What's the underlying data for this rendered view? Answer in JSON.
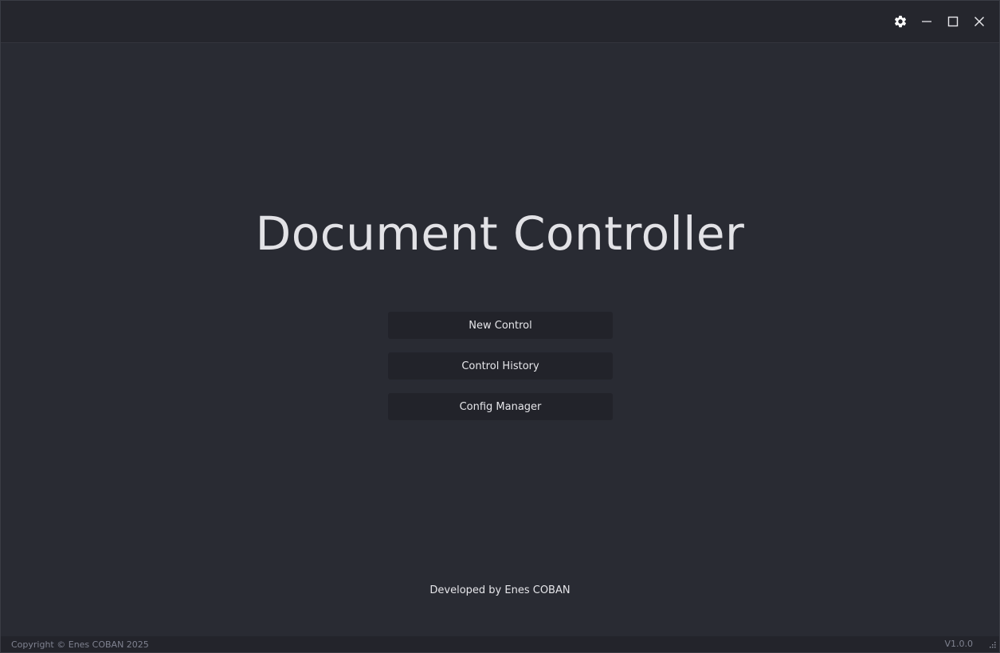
{
  "window": {
    "controls": {
      "settings_icon": "gear-icon",
      "minimize_icon": "minimize-icon",
      "maximize_icon": "maximize-icon",
      "close_icon": "close-icon"
    }
  },
  "main": {
    "title": "Document Controller",
    "buttons": [
      {
        "label": "New Control"
      },
      {
        "label": "Control History"
      },
      {
        "label": "Config Manager"
      }
    ],
    "developer_credit": "Developed by Enes COBAN"
  },
  "statusbar": {
    "copyright": "Copyright © Enes COBAN 2025",
    "version": "V1.0.0"
  },
  "colors": {
    "background": "#292b33",
    "titlebar": "#25262d",
    "button": "#22232a",
    "text": "#e2e2e6",
    "muted_text": "#7f8290"
  }
}
